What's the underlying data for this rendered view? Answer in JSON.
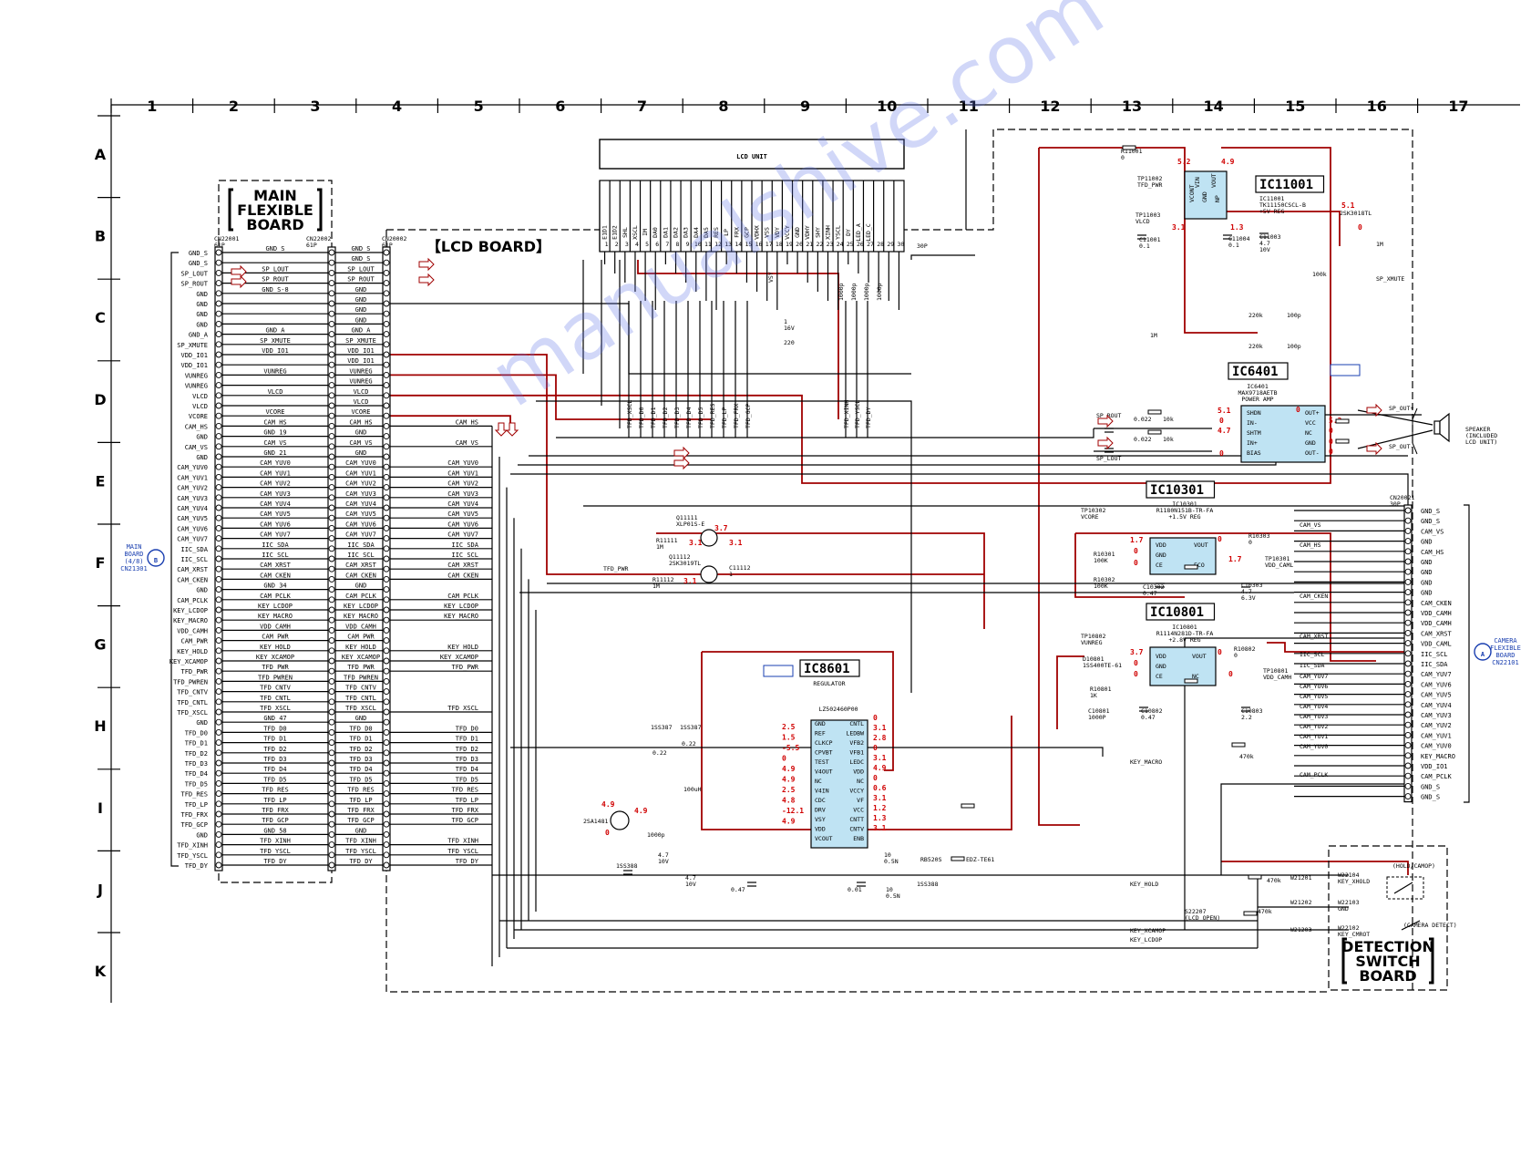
{
  "grid": {
    "columns": [
      "1",
      "2",
      "3",
      "4",
      "5",
      "6",
      "7",
      "8",
      "9",
      "10",
      "11",
      "12",
      "13",
      "14",
      "15",
      "16",
      "17"
    ],
    "rows": [
      "A",
      "B",
      "C",
      "D",
      "E",
      "F",
      "G",
      "H",
      "I",
      "J",
      "K"
    ]
  },
  "boards": {
    "main_flexible": "【MAIN FLEXIBLE BOARD】",
    "main_flexible_lines": [
      "MAIN",
      "FLEXIBLE",
      "BOARD"
    ],
    "lcd": "【LCD BOARD】",
    "detection_switch_lines": [
      "DETECTION",
      "SWITCH",
      "BOARD"
    ]
  },
  "connectors": {
    "cn22001": {
      "ref": "CN22001",
      "pins": "61P"
    },
    "cn22002": {
      "ref": "CN22002",
      "pins": "61P"
    },
    "cn20002": {
      "ref": "CN20002",
      "pins": "61P"
    },
    "cn20021": {
      "ref": "CN20021",
      "pins": "30P"
    },
    "lcd_30p": "30P"
  },
  "main_board_ref": {
    "letter": "B",
    "lines": [
      "MAIN",
      "BOARD",
      "(4/8)",
      "CN21301"
    ]
  },
  "camera_board_ref": {
    "letter": "A",
    "lines": [
      "CAMERA",
      "FLEXIBLE",
      "BOARD",
      "CN22101"
    ]
  },
  "lcd_unit": {
    "title": "LCD UNIT",
    "pins": [
      "E1D1",
      "E1D2",
      "SHL",
      "XSCL",
      "IM",
      "DA0",
      "DA1",
      "DA2",
      "DA3",
      "DA4",
      "DA5",
      "RES",
      "LP",
      "FRX",
      "GCP",
      "VDHX",
      "VSS",
      "VDY",
      "VCCY",
      "GND",
      "VDHY",
      "SHY",
      "XINH",
      "YSCL",
      "DY",
      "LED_A",
      "LED_C"
    ]
  },
  "left_signals": [
    "GND_S",
    "GND_S",
    "SP_LOUT",
    "SP_ROUT",
    "GND",
    "GND",
    "GND",
    "GND",
    "GND_A",
    "SP_XMUTE",
    "VDD_IO1",
    "VDD_IO1",
    "VUNREG",
    "VUNREG",
    "VLCD",
    "VLCD",
    "VCORE",
    "CAM_HS",
    "GND",
    "CAM_VS",
    "GND",
    "CAM_YUV0",
    "CAM_YUV1",
    "CAM_YUV2",
    "CAM_YUV3",
    "CAM_YUV4",
    "CAM_YUV5",
    "CAM_YUV6",
    "CAM_YUV7",
    "IIC_SDA",
    "IIC_SCL",
    "CAM_XRST",
    "CAM_CKEN",
    "GND",
    "CAM_PCLK",
    "KEY_LCDOP",
    "KEY_MACRO",
    "VDD_CAMH",
    "CAM_PWR",
    "KEY_HOLD",
    "KEY_XCAMOP",
    "TFD_PWR",
    "TFD_PWREN",
    "TFD_CNTV",
    "TFD_CNTL",
    "TFD_XSCL",
    "GND",
    "TFD_D0",
    "TFD_D1",
    "TFD_D2",
    "TFD_D3",
    "TFD_D4",
    "TFD_D5",
    "TFD_RES",
    "TFD_LP",
    "TFD_FRX",
    "TFD_GCP",
    "GND",
    "TFD_XINH",
    "TFD_YSCL",
    "TFD_DY"
  ],
  "mid_signals": [
    "GND_S",
    "",
    "SP_LOUT",
    "SP_ROUT",
    "GND_S-8",
    "",
    "",
    "",
    "GND_A",
    "SP_XMUTE",
    "VDD_IO1",
    "",
    "VUNREG",
    "",
    "VLCD",
    "",
    "VCORE",
    "CAM_HS",
    "GND_19",
    "CAM_VS",
    "GND_21",
    "CAM_YUV0",
    "CAM_YUV1",
    "CAM_YUV2",
    "CAM_YUV3",
    "CAM_YUV4",
    "CAM_YUV5",
    "CAM_YUV6",
    "CAM_YUV7",
    "IIC_SDA",
    "IIC_SCL",
    "CAM_XRST",
    "CAM_CKEN",
    "GND_34",
    "CAM_PCLK",
    "KEY_LCDOP",
    "KEY_MACRO",
    "VDD_CAMH",
    "CAM_PWR",
    "KEY_HOLD",
    "KEY_XCAMOP",
    "TFD_PWR",
    "TFD_PWREN",
    "TFD_CNTV",
    "TFD_CNTL",
    "TFD_XSCL",
    "GND_47",
    "TFD_D0",
    "TFD_D1",
    "TFD_D2",
    "TFD_D3",
    "TFD_D4",
    "TFD_D5",
    "TFD_RES",
    "TFD_LP",
    "TFD_FRX",
    "TFD_GCP",
    "GND_58",
    "TFD_XINH",
    "TFD_YSCL",
    "TFD_DY"
  ],
  "lcd_signals": [
    "GND_S",
    "GND_S",
    "SP_LOUT",
    "SP_ROUT",
    "GND",
    "GND",
    "GND",
    "GND",
    "GND_A",
    "SP_XMUTE",
    "VDD_IO1",
    "VDD_IO1",
    "VUNREG",
    "VUNREG",
    "VLCD",
    "VLCD",
    "VCORE",
    "CAM_HS",
    "GND",
    "CAM_VS",
    "GND",
    "CAM_YUV0",
    "CAM_YUV1",
    "CAM_YUV2",
    "CAM_YUV3",
    "CAM_YUV4",
    "CAM_YUV5",
    "CAM_YUV6",
    "CAM_YUV7",
    "IIC_SDA",
    "IIC_SCL",
    "CAM_XRST",
    "CAM_CKEN",
    "GND",
    "CAM_PCLK",
    "KEY_LCDOP",
    "KEY_MACRO",
    "VDD_CAMH",
    "CAM_PWR",
    "KEY_HOLD",
    "KEY_XCAMOP",
    "TFD_PWR",
    "TFD_PWREN",
    "TFD_CNTV",
    "TFD_CNTL",
    "TFD_XSCL",
    "GND",
    "TFD_D0",
    "TFD_D1",
    "TFD_D2",
    "TFD_D3",
    "TFD_D4",
    "TFD_D5",
    "TFD_RES",
    "TFD_LP",
    "TFD_FRX",
    "TFD_GCP",
    "GND",
    "TFD_XINH",
    "TFD_YSCL",
    "TFD_DY"
  ],
  "right_connector_signals": [
    "GND_S",
    "GND_S",
    "CAM_VS",
    "GND",
    "CAM_HS",
    "GND",
    "GND",
    "GND",
    "GND",
    "CAM_CKEN",
    "VDD_CAMH",
    "VDD_CAMH",
    "CAM_XRST",
    "VDD_CAML",
    "IIC_SCL",
    "IIC_SDA",
    "CAM_YUV7",
    "CAM_YUV6",
    "CAM_YUV5",
    "CAM_YUV4",
    "CAM_YUV3",
    "CAM_YUV2",
    "CAM_YUV1",
    "CAM_YUV0",
    "KEY_MACRO",
    "VDD_IO1",
    "CAM_PCLK",
    "GND_S",
    "GND_S"
  ],
  "ics": {
    "ic11001": {
      "label": "IC11001",
      "part": "IC11001",
      "desc": "TK11150CSCL-B",
      "func": "+5V REG",
      "pins": [
        "VCONT",
        "GND",
        "NP",
        "VIN",
        "VOUT"
      ]
    },
    "ic6401": {
      "label": "IC6401",
      "part": "IC6401",
      "desc": "MAX9718AETB",
      "func": "POWER AMP",
      "pins_l": [
        "SHDN",
        "IN-",
        "SHTM",
        "IN+",
        "BIAS"
      ],
      "pins_r": [
        "OUT+",
        "VCC",
        "NC",
        "GND",
        "OUT-"
      ]
    },
    "ic10301": {
      "label": "IC10301",
      "part": "IC10301",
      "desc": "R1180N151B-TR-FA",
      "func": "+1.5V REG",
      "pins_l": [
        "VDD",
        "GND",
        "CE"
      ],
      "pins_r": [
        "VOUT",
        "ECO"
      ]
    },
    "ic10801": {
      "label": "IC10801",
      "part": "IC10801",
      "desc": "R1114N281D-TR-FA",
      "func": "+2.8V REG",
      "pins_l": [
        "VDD",
        "GND",
        "CE"
      ],
      "pins_r": [
        "VOUT",
        "NC"
      ]
    },
    "ic8601": {
      "label": "IC8601",
      "func": "REGULATOR",
      "part": "LZ502460P00",
      "pins_l": [
        "GND",
        "REF",
        "CLKCP",
        "CPVBT",
        "TEST",
        "V4OUT",
        "NC",
        "V4IN",
        "CDC",
        "DRV",
        "VSY",
        "VDD",
        "VCOUT"
      ],
      "pins_r": [
        "CNTL",
        "LEDBW",
        "VFB2",
        "VFB1",
        "LEDC",
        "VDD",
        "NC",
        "VCCY",
        "VF",
        "VCC",
        "CNTT",
        "CNTV",
        "ENB"
      ]
    }
  },
  "voltages": {
    "ic11001": [
      "5.2",
      "4.9",
      "3.1",
      "1.3",
      "5.1",
      "0"
    ],
    "ic6401": [
      "5.1",
      "4.7",
      "0",
      "0",
      "0",
      "5.2",
      "0",
      "0",
      "0"
    ],
    "ic10301": [
      "1.7",
      "0",
      "0",
      "0",
      "1.7"
    ],
    "ic10801": [
      "3.7",
      "0",
      "0",
      "0",
      "0"
    ],
    "ic8601_l": [
      "2.5",
      "1.5",
      "-5.5",
      "0",
      "4.9",
      "4.9",
      "2.5",
      "4.8",
      "-12.1",
      "4.9"
    ],
    "ic8601_r": [
      "0",
      "3.1",
      "2.8",
      "0",
      "3.1",
      "4.9",
      "0",
      "0.6",
      "3.1",
      "1.2",
      "1.3",
      "3.1"
    ],
    "q11111": [
      "3.7",
      "3.1",
      "3.1"
    ],
    "q2sa": [
      "4.9",
      "4.9",
      "0"
    ]
  },
  "parts": {
    "r11001": "R11001\n0",
    "tp11002": "TP11002\nTFD_PWR",
    "tp11003": "TP11003\nVLCD",
    "c11001": "C11001\n0.1",
    "c11004": "C11004\n0.1",
    "c11003": "C11003\n4.7\n10V",
    "q2sk": "2SK3018TL",
    "r_1m": "1M",
    "r_100k": "100k",
    "sp_xmute": "SP_XMUTE",
    "r220k": "220k",
    "c100p": "100p",
    "sp_rout": "SP_ROUT",
    "sp_lout": "SP_LOUT",
    "c0022": "0.022",
    "r10k": "10k",
    "sp_outp": "SP_OUT+",
    "sp_outm": "SP_OUT-",
    "speaker": "SPEAKER\n(INCLUDED\nLCD UNIT)",
    "tp10302": "TP10302\nVCORE",
    "r10301": "R10301\n100K",
    "r10302": "R10302\n100K",
    "c10302": "C10302\n0.47",
    "r10303": "R10303\n0",
    "tp10301": "TP10301\nVDD_CAML",
    "c10303": "C10303\n4.7\n6.3V",
    "tp10802": "TP10802\nVUNREG",
    "d10801": "D10801\n1SS400TE-61",
    "r10801": "R10801\n1K",
    "c10801": "C10801\n1000P",
    "c10802": "C10802\n0.47",
    "r10802": "R10802\n0",
    "tp10801": "TP10801\nVDD_CAMH",
    "c10803": "C10803\n2.2",
    "q11111": "Q11111\nXLP01S-E",
    "q11112": "Q11112\n2SK3019TL",
    "r11111": "R11111\n1M",
    "r11112": "R11112\n1M",
    "c11112": "C11112\n1",
    "tfd_pwr": "TFD_PWR",
    "d1ss387": "1SS387",
    "d1ss388": "1SS388",
    "q2sa1481": "2SA1481",
    "l100uh": "100uH",
    "rb520s": "RB520S",
    "edz": "EDZ-TE61",
    "c047": "0.47",
    "c001": "0.01",
    "c022": "0.22",
    "c1000p": "1000p",
    "c47_10v": "4.7\n10V",
    "c10_05n": "10\n0.5N",
    "r470k": "470k",
    "key_macro": "KEY_MACRO",
    "key_hold": "KEY_HOLD",
    "key_xcamop": "KEY_XCAMOP",
    "key_lcdop": "KEY_LCDOP",
    "s22207": "S22207\n(LCD OPEN)",
    "w21201": "W21201",
    "w21202": "W21202",
    "w21203": "W21203",
    "w22104": "W22104\nKEY_XHOLD",
    "w22103": "W22103\nGND",
    "w22102": "W22102\nKEY_CMROT",
    "hold_camop": "(HOLD/CAMOP)",
    "camera_detect": "(CAMERA DETECT)",
    "cam_vs": "CAM_VS",
    "cam_hs": "CAM_HS",
    "cam_cken": "CAM_CKEN",
    "cam_xrst": "CAM_XRST",
    "iic_scl": "IIC_SCL",
    "iic_sda": "IIC_SDA",
    "cam_pclk": "CAM_PCLK",
    "cam_yuv": [
      "CAM_YUV7",
      "CAM_YUV6",
      "CAM_YUV5",
      "CAM_YUV4",
      "CAM_YUV3",
      "CAM_YUV2",
      "CAM_YUV1",
      "CAM_YUV0"
    ],
    "tfd_lines": [
      "TFD_XSCL",
      "TFD_D0",
      "TFD_D1",
      "TFD_D2",
      "TFD_D3",
      "TFD_D4",
      "TFD_D5",
      "TFD_RES",
      "TFD_LP",
      "TFD_FRX",
      "TFD_GCP"
    ],
    "tfd_lines2": [
      "TFD_XINH",
      "TFD_YSCL",
      "TFD_DY"
    ],
    "c1000p_set": [
      "1000p",
      "1000p",
      "1000p",
      "1000p"
    ],
    "c16v": "1\n16V",
    "c220": "220",
    "c10k": "10k",
    "c1": "1",
    "vsy": "VSY"
  },
  "watermark": "manualshive.com",
  "colors": {
    "wire": "#000000",
    "power_wire": "#a00000",
    "voltage": "#d00000",
    "ic_fill": "#bfe3f3",
    "ref_blue": "#1a3fb0",
    "watermark": "#6a78e0"
  }
}
